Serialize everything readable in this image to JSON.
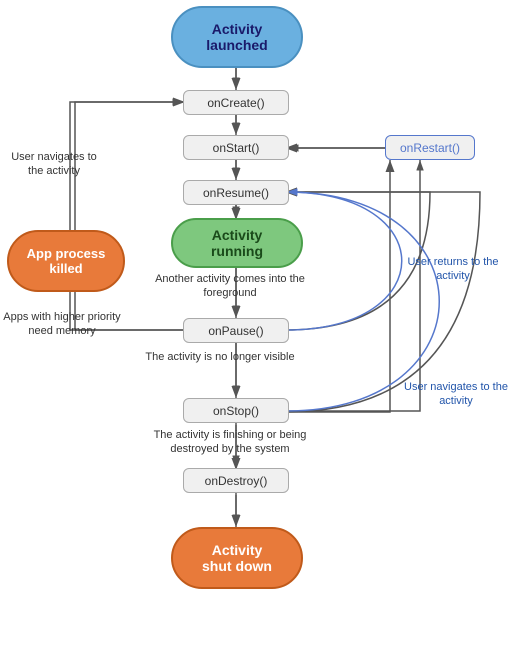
{
  "nodes": {
    "activity_launched": {
      "label": "Activity\nlaunched"
    },
    "on_create": {
      "label": "onCreate()"
    },
    "on_start": {
      "label": "onStart()"
    },
    "on_resume": {
      "label": "onResume()"
    },
    "activity_running": {
      "label": "Activity\nrunning"
    },
    "on_pause": {
      "label": "onPause()"
    },
    "on_stop": {
      "label": "onStop()"
    },
    "on_destroy": {
      "label": "onDestroy()"
    },
    "activity_shut_down": {
      "label": "Activity\nshut down"
    },
    "on_restart": {
      "label": "onRestart()"
    },
    "app_process_killed": {
      "label": "App process\nkilled"
    }
  },
  "labels": {
    "user_navigates_to": "User navigates\nto the activity",
    "another_activity": "Another activity comes\ninto the foreground",
    "apps_higher_priority": "Apps with higher priority\nneed memory",
    "activity_no_longer": "The activity is\nno longer visible",
    "activity_finishing": "The activity is finishing or\nbeing destroyed by the system",
    "user_returns": "User returns\nto the activity",
    "user_navigates_to2": "User navigates\nto the activity"
  }
}
